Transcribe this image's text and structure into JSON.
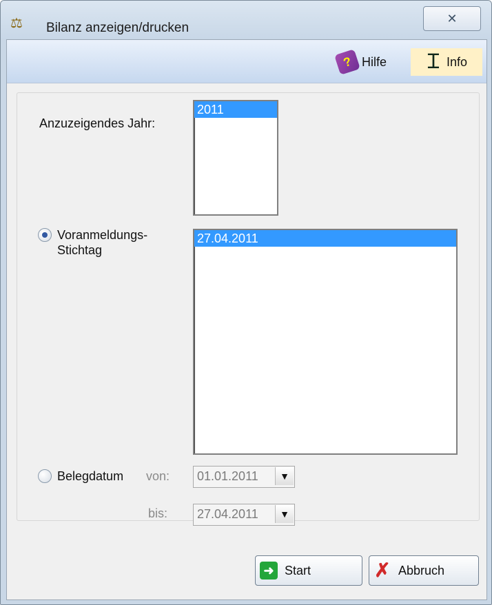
{
  "window": {
    "title": "Bilanz anzeigen/drucken",
    "app_icon": "scales-icon",
    "close_glyph": "✕"
  },
  "toolbar": {
    "hilfe": "Hilfe",
    "info": "Info",
    "hilfe_icon": "help-book-icon",
    "info_icon": "ibeam-icon"
  },
  "year": {
    "label": "Anzuzeigendes Jahr:",
    "options": [
      "2011"
    ],
    "selected": "2011"
  },
  "voranmeldung": {
    "label_line1": "Voranmeldungs-",
    "label_line2": "Stichtag",
    "selected": true,
    "dates": [
      "27.04.2011"
    ]
  },
  "belegdatum": {
    "label": "Belegdatum",
    "selected": false,
    "from_label": "von:",
    "from_value": "01.01.2011",
    "to_label": "bis:",
    "to_value": "27.04.2011"
  },
  "buttons": {
    "start": "Start",
    "cancel": "Abbruch"
  },
  "colors": {
    "selection": "#3399ff",
    "toolbar_active": "#fff1c7",
    "start_icon": "#24a63a",
    "cancel_icon": "#d12a2a"
  }
}
